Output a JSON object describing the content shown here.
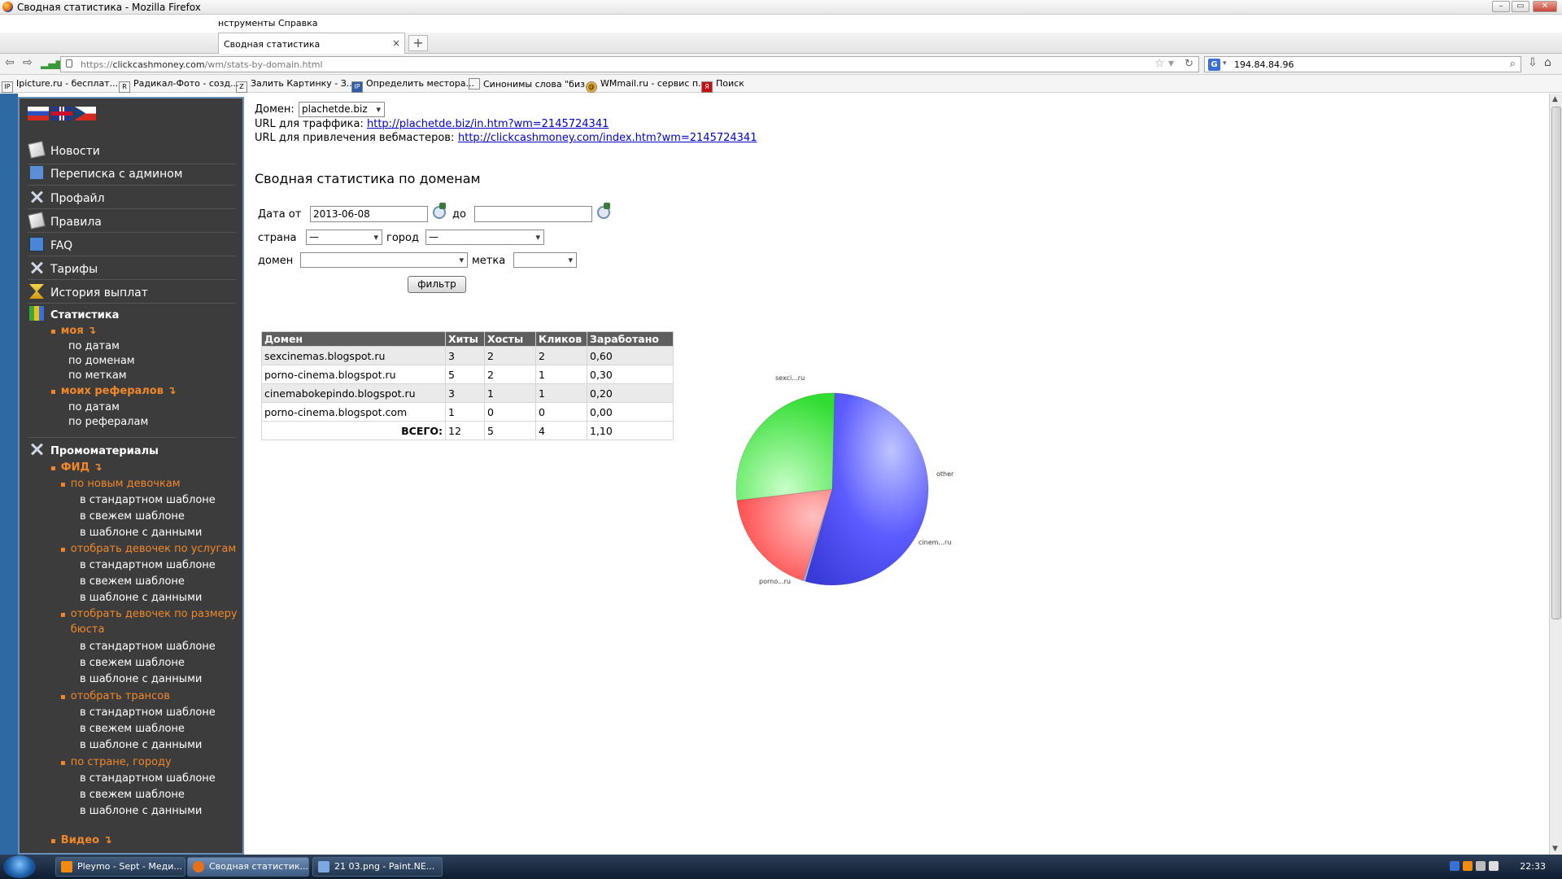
{
  "window": {
    "title": "Сводная статистика - Mozilla Firefox"
  },
  "menu": {
    "tools": "нструменты",
    "help": "Справка"
  },
  "tab": {
    "title": "Сводная статистика",
    "close": "×",
    "new": "+"
  },
  "nav": {
    "url_prefix": "https://",
    "url_host": "clickcashmoney.com",
    "url_path": "/wm/stats-by-domain.html",
    "search_engine": "G",
    "search_value": "194.84.84.96"
  },
  "bookmarks": [
    {
      "icon": "IP",
      "label": "Ipicture.ru - бесплат..."
    },
    {
      "icon": "R",
      "label": "Радикал-Фото - созд..."
    },
    {
      "icon": "Z",
      "label": "Залить Картинку - З..."
    },
    {
      "icon": "IP",
      "label": "Определить местора..."
    },
    {
      "icon": "",
      "label": "Синонимы слова \"биз..."
    },
    {
      "icon": "@",
      "label": "WMmail.ru - сервис п..."
    },
    {
      "icon": "Я",
      "label": "Поиск"
    }
  ],
  "sidebar": {
    "items": [
      {
        "label": "Новости"
      },
      {
        "label": "Переписка с админом"
      },
      {
        "label": "Профайл"
      },
      {
        "label": "Правила"
      },
      {
        "label": "FAQ"
      },
      {
        "label": "Тарифы"
      },
      {
        "label": "История выплат"
      }
    ],
    "stats_head": "Статистика",
    "my": "моя ↴",
    "my_links": [
      "по датам",
      "по доменам",
      "по меткам"
    ],
    "referrals": "моих рефералов ↴",
    "ref_links": [
      "по датам",
      "по рефералам"
    ],
    "promo_head": "Промоматериалы",
    "feed": "ФИД ↴",
    "groups": [
      {
        "title": "по новым девочкам",
        "links": [
          "в стандартном шаблоне",
          "в свежем шаблоне",
          "в шаблоне с данными"
        ]
      },
      {
        "title": "отобрать девочек по услугам",
        "links": [
          "в стандартном шаблоне",
          "в свежем шаблоне",
          "в шаблоне с данными"
        ]
      },
      {
        "title": "отобрать девочек по размеру",
        "title2": "бюста",
        "links": [
          "в стандартном шаблоне",
          "в свежем шаблоне",
          "в шаблоне с данными"
        ]
      },
      {
        "title": "отобрать трансов",
        "links": [
          "в стандартном шаблоне",
          "в свежем шаблоне",
          "в шаблоне с данными"
        ]
      },
      {
        "title": "по стране, городу",
        "links": [
          "в стандартном шаблоне",
          "в свежем шаблоне",
          "в шаблоне с данными"
        ]
      }
    ],
    "video": "Видео ↴"
  },
  "content": {
    "domain_label": "Домен:",
    "domain_value": "plachetde.biz",
    "traffic_label": "URL для траффика:",
    "traffic_url": "http://plachetde.biz/in.htm?wm=2145724341",
    "webmasters_label": "URL для привлечения вебмастеров:",
    "webmasters_url": "http://clickcashmoney.com/index.htm?wm=2145724341",
    "heading": "Сводная статистика по доменам",
    "filters": {
      "date_from_label": "Дата от",
      "date_from": "2013-06-08",
      "date_to_label": "до",
      "date_to": "",
      "country_label": "страна",
      "country": "—",
      "city_label": "город",
      "city": "—",
      "domain_label": "домен",
      "domain": "",
      "tag_label": "метка",
      "tag": "",
      "button": "фильтр"
    },
    "table": {
      "headers": [
        "Домен",
        "Хиты",
        "Хосты",
        "Кликов",
        "Заработано"
      ],
      "rows": [
        [
          "sexcinemas.blogspot.ru",
          "3",
          "2",
          "2",
          "0,60"
        ],
        [
          "porno-cinema.blogspot.ru",
          "5",
          "2",
          "1",
          "0,30"
        ],
        [
          "cinemabokepindo.blogspot.ru",
          "3",
          "1",
          "1",
          "0,20"
        ],
        [
          "porno-cinema.blogspot.com",
          "1",
          "0",
          "0",
          "0,00"
        ]
      ],
      "total": [
        "ВСЕГО:",
        "12",
        "5",
        "4",
        "1,10"
      ]
    }
  },
  "chart_data": {
    "type": "pie",
    "labels": [
      "sexci...ru",
      "other",
      "cinem...ru",
      "porno...ru"
    ],
    "values": [
      0.6,
      0.0,
      0.2,
      0.3
    ],
    "colors": [
      "#4444ff",
      "#aaaadd",
      "#ff4444",
      "#44cc44"
    ],
    "note_exploded": "sexci...ru"
  },
  "taskbar": {
    "tasks": [
      "Pleymo - Sept - Меди...",
      "Сводная статистик...",
      "21 03.png - Paint.NE..."
    ],
    "clock": "22:33"
  },
  "colors": {
    "sidebar_bg": "#3c3c3c",
    "orange": "#f0882a",
    "link": "#0000cc",
    "table_head": "#5e5e5e"
  }
}
